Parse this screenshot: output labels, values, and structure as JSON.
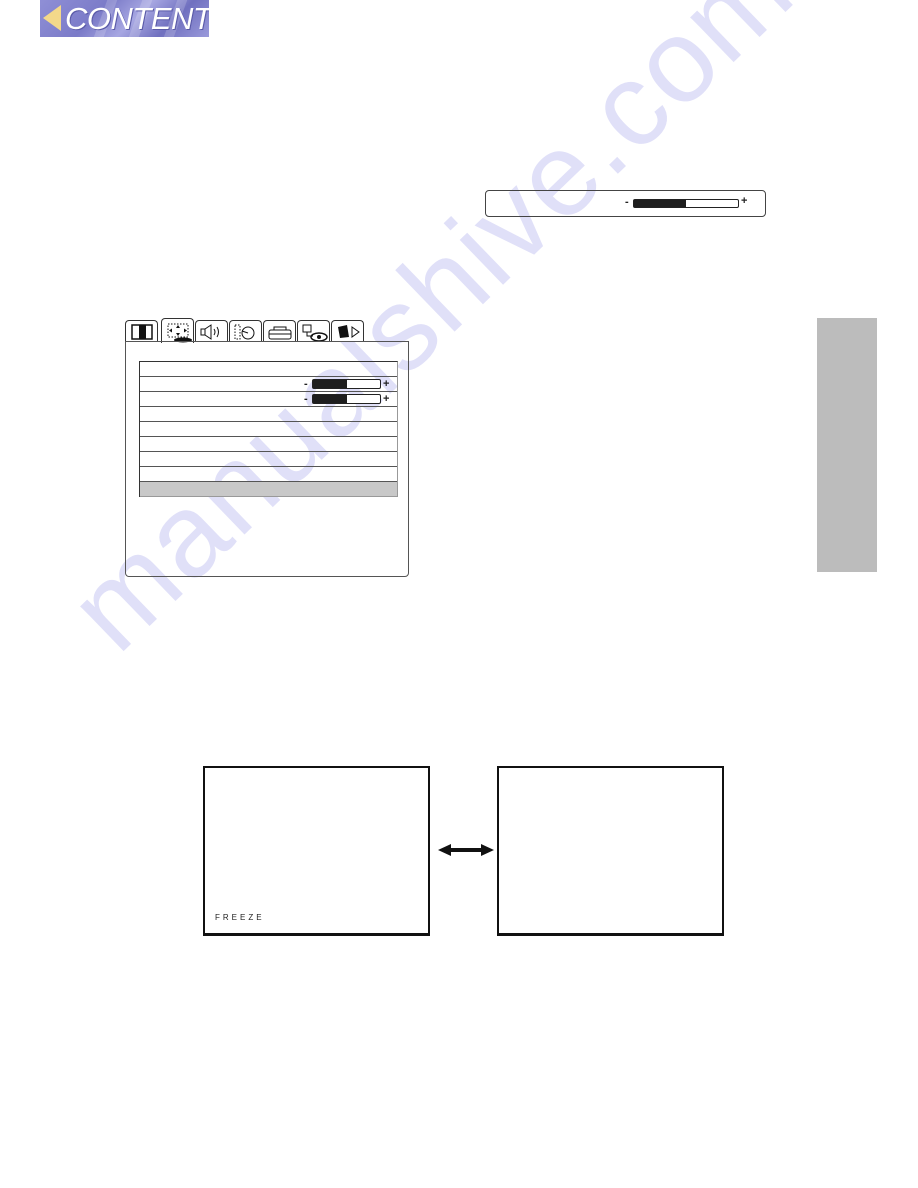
{
  "header": {
    "contents_button": {
      "label": "CONTENTS",
      "icon": "left-arrow-icon"
    }
  },
  "adjust_bar": {
    "minus_label": "-",
    "plus_label": "+",
    "level_percent": 50
  },
  "osd_menu": {
    "tabs": [
      {
        "icon": "picture-icon",
        "active": false
      },
      {
        "icon": "image-position-icon",
        "active": true
      },
      {
        "icon": "sound-icon",
        "active": false
      },
      {
        "icon": "timer-icon",
        "active": false
      },
      {
        "icon": "input-icon",
        "active": false
      },
      {
        "icon": "setup-icon",
        "active": false
      },
      {
        "icon": "options-icon",
        "active": false
      }
    ],
    "rows": [
      {
        "has_slider": false,
        "selected": false
      },
      {
        "has_slider": true,
        "level_percent": 50,
        "minus_label": "-",
        "plus_label": "+",
        "selected": false
      },
      {
        "has_slider": true,
        "level_percent": 50,
        "minus_label": "-",
        "plus_label": "+",
        "selected": false
      },
      {
        "has_slider": false,
        "selected": false
      },
      {
        "has_slider": false,
        "selected": false
      },
      {
        "has_slider": false,
        "selected": false
      },
      {
        "has_slider": false,
        "selected": false
      },
      {
        "has_slider": false,
        "selected": false
      },
      {
        "has_slider": false,
        "selected": true
      }
    ]
  },
  "freeze_demo": {
    "left_screen_label": "FREEZE",
    "arrow_icon": "double-arrow-icon"
  },
  "watermark": {
    "text": "manualshive.com"
  },
  "colors": {
    "contents_bg": "#8484cf",
    "contents_arrow": "#f3d88a",
    "side_tab": "#bcbcbc",
    "selected_row": "#c8c8c8",
    "slider_fill": "#1e1e1e",
    "watermark": "#d6d6f6"
  }
}
